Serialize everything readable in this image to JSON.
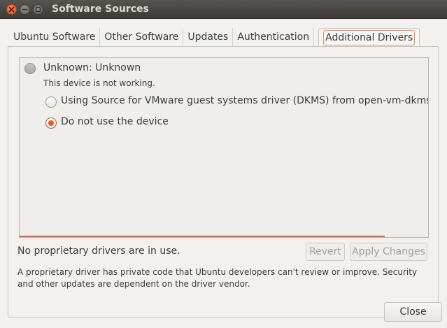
{
  "window": {
    "title": "Software Sources",
    "controls": {
      "close": "close-icon",
      "minimize": "minimize-icon",
      "maximize": "maximize-icon"
    }
  },
  "tabs": [
    {
      "label": "Ubuntu Software"
    },
    {
      "label": "Other Software"
    },
    {
      "label": "Updates"
    },
    {
      "label": "Authentication"
    },
    {
      "label": "Additional Drivers",
      "active": true
    }
  ],
  "drivers": {
    "device_name": "Unknown: Unknown",
    "device_status": "This device is not working.",
    "options": [
      {
        "label": "Using Source for VMware guest systems driver (DKMS) from open-vm-dkms (pr",
        "selected": false
      },
      {
        "label": "Do not use the device",
        "selected": true
      }
    ]
  },
  "status": "No proprietary drivers are in use.",
  "buttons": {
    "revert": "Revert",
    "apply": "Apply Changes",
    "close": "Close"
  },
  "note": "A proprietary driver has private code that Ubuntu developers can't review or improve. Security and other updates are dependent on the driver vendor.",
  "colors": {
    "accent": "#e0683a",
    "titlebar": "#3c3b37",
    "background": "#f2f1f0"
  }
}
